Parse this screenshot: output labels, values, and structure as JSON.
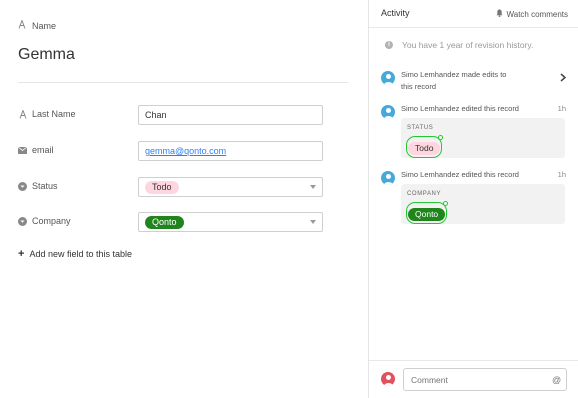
{
  "record": {
    "primary_field_label": "Name",
    "primary_value": "Gemma",
    "fields": [
      {
        "label": "Last Name",
        "icon": "text-a-icon",
        "value": "Chan"
      },
      {
        "label": "email",
        "icon": "envelope-icon",
        "value": "gemma@qonto.com"
      },
      {
        "label": "Status",
        "icon": "single-select-icon",
        "value": "Todo",
        "color": "#ffd6e0"
      },
      {
        "label": "Company",
        "icon": "single-select-icon",
        "value": "Qonto",
        "color": "#20851c"
      }
    ],
    "add_field_label": "Add new field to this table"
  },
  "activity": {
    "title": "Activity",
    "watch_label": "Watch comments",
    "revision_notice": "You have 1 year of revision history.",
    "events": [
      {
        "author_text": "Simo Lemhandez made edits to",
        "author_text2": "this record",
        "time": ""
      },
      {
        "author_text": "Simo Lemhandez edited this record",
        "time": "1h",
        "field": "STATUS",
        "value": "Todo"
      },
      {
        "author_text": "Simo Lemhandez edited this record",
        "time": "1h",
        "field": "COMPANY",
        "value": "Qonto"
      }
    ],
    "comment_placeholder": "Comment",
    "mention_symbol": "@"
  },
  "colors": {
    "accent_link": "#2d7ff9",
    "avatar": "#47a9d9",
    "current_user_avatar": "#e0525c",
    "todo_pill": "#ffd6e0",
    "qonto_pill": "#20851c",
    "added_outline": "#20c933"
  }
}
